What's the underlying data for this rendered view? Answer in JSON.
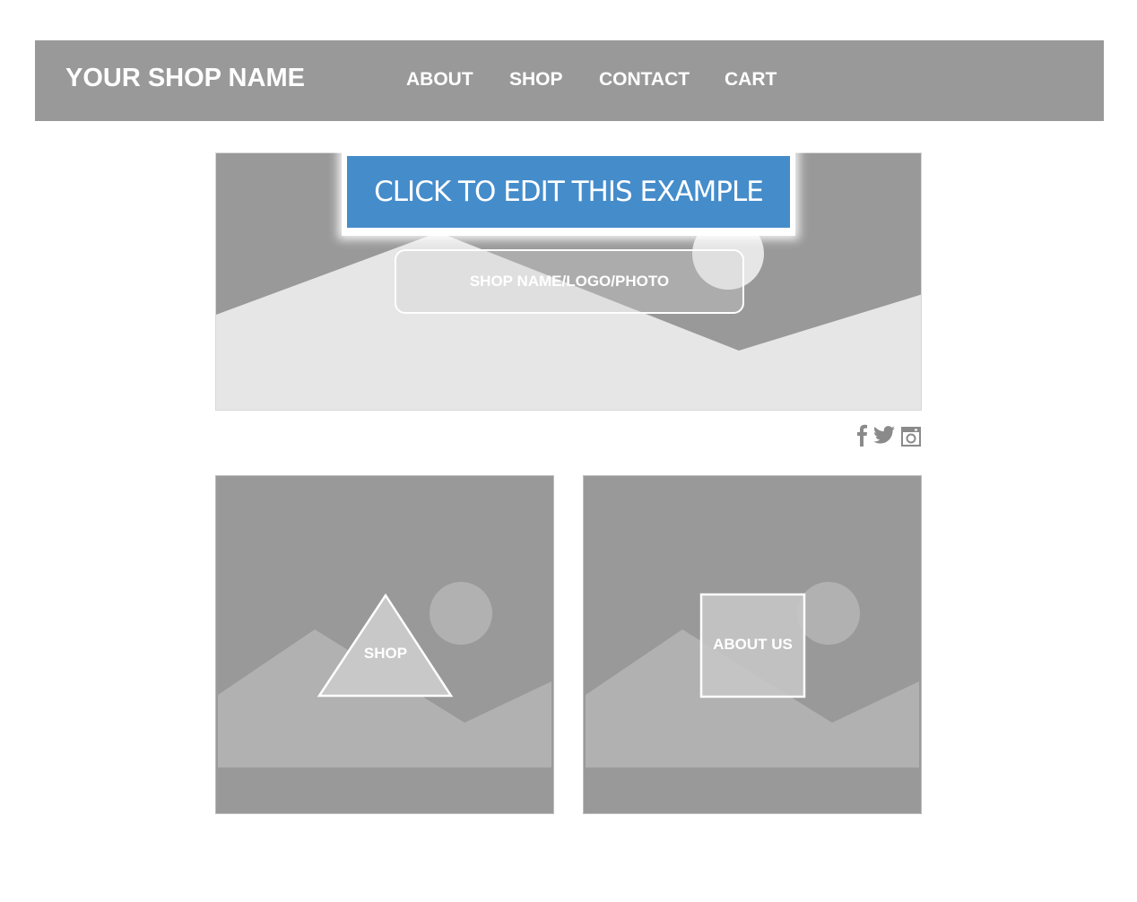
{
  "header": {
    "shop_name": "YOUR SHOP NAME",
    "nav": [
      {
        "label": "ABOUT"
      },
      {
        "label": "SHOP"
      },
      {
        "label": "CONTACT"
      },
      {
        "label": "CART"
      }
    ]
  },
  "hero": {
    "logo_placeholder": "SHOP NAME/LOGO/PHOTO"
  },
  "edit_banner": {
    "label": "CLICK TO EDIT THIS EXAMPLE"
  },
  "social": {
    "icons": [
      "facebook-icon",
      "twitter-icon",
      "instagram-icon"
    ]
  },
  "tiles": [
    {
      "label": "SHOP",
      "shape": "triangle"
    },
    {
      "label": "ABOUT US",
      "shape": "square"
    }
  ],
  "colors": {
    "header_bg": "#999999",
    "placeholder_gray": "#999999",
    "light_gray": "#e6e6e6",
    "banner_blue": "#458ccb",
    "white": "#ffffff"
  }
}
